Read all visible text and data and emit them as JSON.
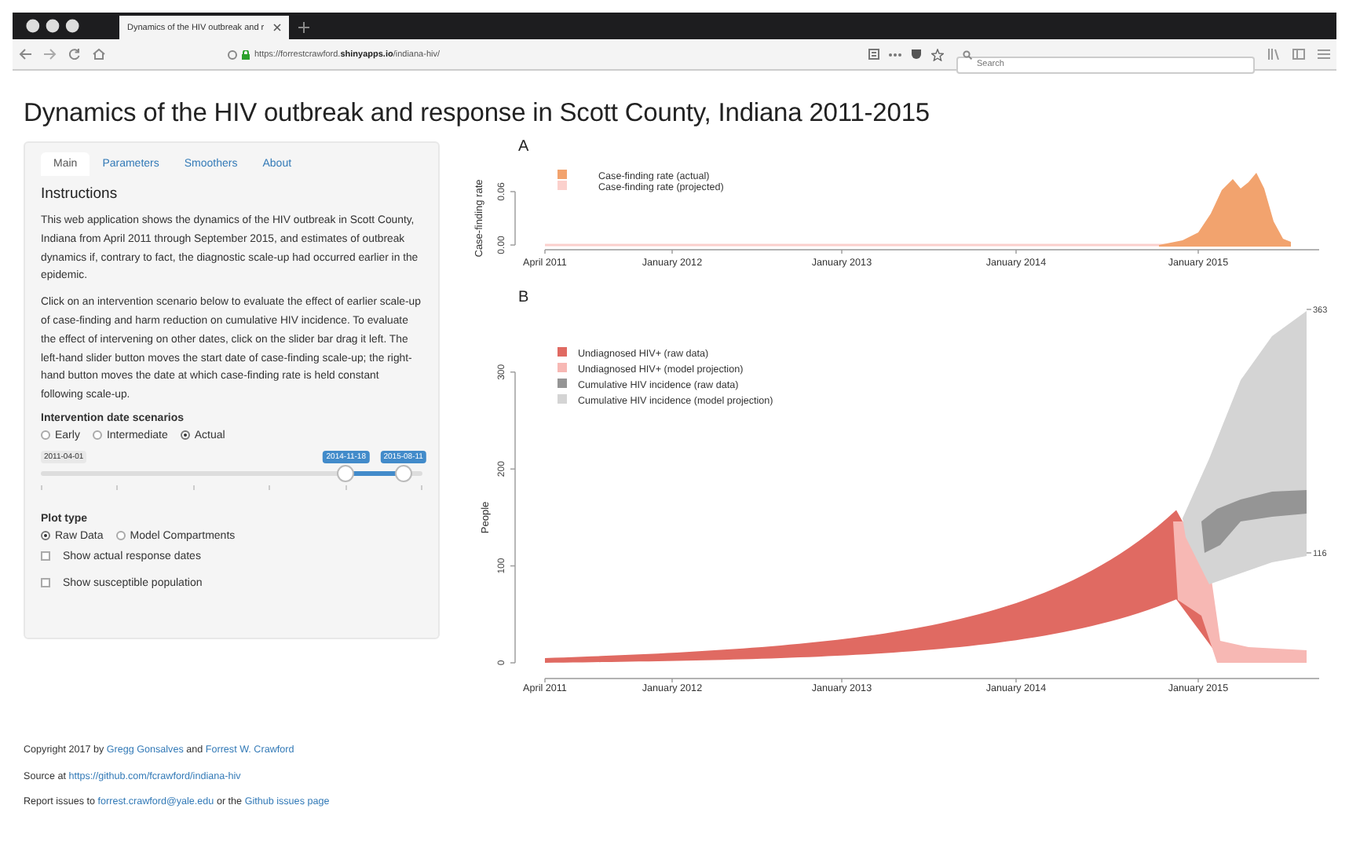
{
  "browser": {
    "tab_title": "Dynamics of the HIV outbreak and r",
    "url": "https://forrestcrawford.**shinyapps.io**/indiana-hiv/",
    "search": {
      "placeholder": "Search"
    }
  },
  "title": "Dynamics of the HIV outbreak and response in Scott County, Indiana 2011-2015",
  "sidebar": {
    "tabs": [
      {
        "label": "Main",
        "selected": true
      },
      {
        "label": "Parameters",
        "selected": false
      },
      {
        "label": "Smoothers",
        "selected": false
      },
      {
        "label": "About",
        "selected": false
      }
    ],
    "heading": "Instructions",
    "paragraphs": [
      "This web application shows the dynamics of the HIV outbreak in Scott County, Indiana from April 2011 through September 2015, and estimates of outbreak dynamics if, contrary to fact, the diagnostic scale-up had occurred earlier in the epidemic.",
      "Click on an intervention scenario below to evaluate the effect of earlier scale-up of case-finding and harm reduction on cumulative HIV incidence. To evaluate the effect of intervening on other dates, click on the slider bar drag it left. The left-hand slider button moves the start date of case-finding scale-up; the right-hand button moves the date at which case-finding rate is held constant following scale-up."
    ],
    "scenarios": {
      "label": "Intervention date scenarios",
      "options": [
        {
          "label": "Early",
          "selected": false
        },
        {
          "label": "Intermediate",
          "selected": false
        },
        {
          "label": "Actual",
          "selected": true
        }
      ]
    },
    "slider": {
      "min_label": "2011-04-01",
      "from": {
        "label": "2014-11-18",
        "level": 0.8
      },
      "to": {
        "label": "2015-08-11",
        "level": 0.95
      }
    },
    "plot_type": {
      "label": "Plot type",
      "options": [
        {
          "label": "Raw Data",
          "selected": true
        },
        {
          "label": "Model Compartments",
          "selected": false
        }
      ]
    },
    "checkboxes": [
      {
        "label": "Show actual response dates",
        "checked": false
      },
      {
        "label": "Show susceptible population",
        "checked": false
      }
    ]
  },
  "plots": [
    {
      "kind": "rate",
      "letter": "A",
      "ylabel": "Case-finding rate",
      "yticks": [
        "0.00",
        "0.06"
      ],
      "xticks": [
        "April 2011",
        "January 2012",
        "January 2013",
        "January 2014",
        "January 2015"
      ],
      "legend": [
        {
          "label": "Case-finding rate (actual)",
          "color": "#f2a36e"
        },
        {
          "label": "Case-finding rate (projected)",
          "color": "#fbd0cc"
        }
      ]
    },
    {
      "kind": "people",
      "letter": "B",
      "ylabel": "People",
      "yticks": [
        "0",
        "100",
        "200",
        "300"
      ],
      "xticks": [
        "April 2011",
        "January 2012",
        "January 2013",
        "January 2014",
        "January 2015"
      ],
      "legend": [
        {
          "label": "Undiagnosed HIV+ (raw data)",
          "color": "#e06a62"
        },
        {
          "label": "Undiagnosed HIV+ (model projection)",
          "color": "#f7b8b4"
        },
        {
          "label": "Cumulative HIV incidence (raw data)",
          "color": "#959595"
        },
        {
          "label": "Cumulative HIV incidence (model projection)",
          "color": "#d4d4d4"
        }
      ],
      "end_labels": [
        "363",
        "116"
      ]
    }
  ],
  "footer": [
    [
      {
        "text": "Copyright 2017 by "
      },
      {
        "text": "Gregg Gonsalves",
        "link": true
      },
      {
        "text": " and "
      },
      {
        "text": "Forrest W. Crawford",
        "link": true
      }
    ],
    [
      {
        "text": "Source at "
      },
      {
        "text": "https://github.com/fcrawford/indiana-hiv",
        "link": true
      }
    ],
    [
      {
        "text": "Report issues to "
      },
      {
        "text": "forrest.crawford@yale.edu",
        "link": true
      },
      {
        "text": " or the "
      },
      {
        "text": "Github issues page",
        "link": true
      }
    ]
  ]
}
